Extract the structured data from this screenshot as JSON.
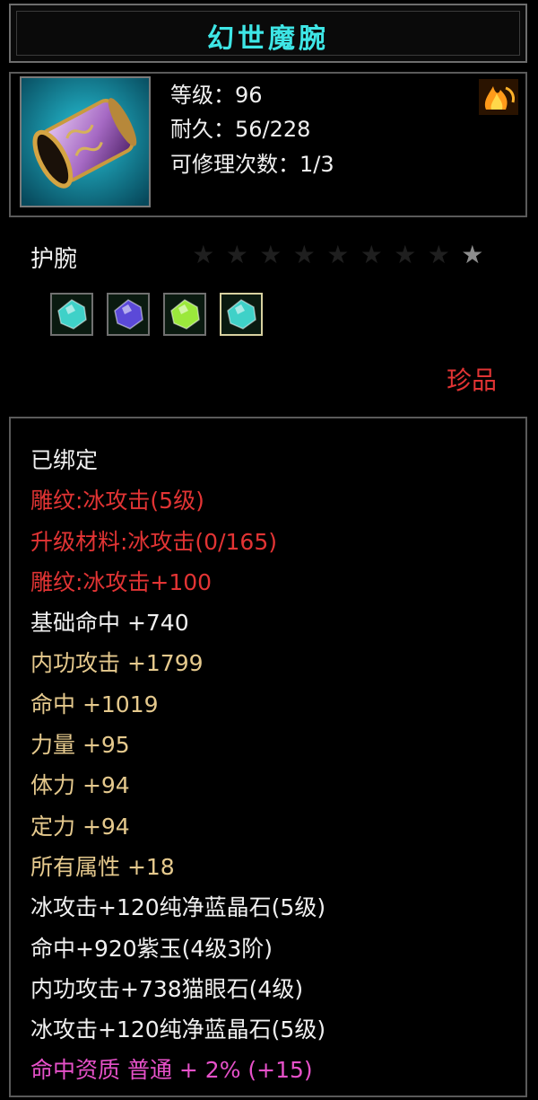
{
  "item": {
    "name": "幻世魔腕",
    "level_line": "等级：96",
    "durability_line": "耐久：56/228",
    "repair_line": "可修理次数：1/3",
    "type": "护腕",
    "star_total": 9,
    "stars_lit": 1,
    "rarity": "珍品",
    "icon": "wristguard-icon"
  },
  "gems": [
    {
      "icon": "cyan-gem-icon",
      "color": "#3fd1c8"
    },
    {
      "icon": "purple-gem-icon",
      "color": "#5b49d8"
    },
    {
      "icon": "green-gem-icon",
      "color": "#9be83c"
    },
    {
      "icon": "cyan-gem-icon",
      "color": "#3fd1c8"
    }
  ],
  "colors": {
    "title": "#3ee6e6",
    "white": "#f0f0f0",
    "gold": "#e5c98d",
    "red": "#e23434",
    "magenta": "#e651c9"
  },
  "attributes": [
    {
      "text": "已绑定",
      "color": "#f0f0f0"
    },
    {
      "text": "雕纹:冰攻击(5级)",
      "color": "#e23434"
    },
    {
      "text": "升级材料:冰攻击(0/165)",
      "color": "#e23434"
    },
    {
      "text": "雕纹:冰攻击+100",
      "color": "#e23434"
    },
    {
      "text": "基础命中 +740",
      "color": "#f0f0f0"
    },
    {
      "text": "内功攻击 +1799",
      "color": "#e5c98d"
    },
    {
      "text": "命中 +1019",
      "color": "#e5c98d"
    },
    {
      "text": "力量 +95",
      "color": "#e5c98d"
    },
    {
      "text": "体力 +94",
      "color": "#e5c98d"
    },
    {
      "text": "定力 +94",
      "color": "#e5c98d"
    },
    {
      "text": "所有属性 +18",
      "color": "#e5c98d"
    },
    {
      "text": "冰攻击+120纯净蓝晶石(5级)",
      "color": "#f0f0f0"
    },
    {
      "text": "命中+920紫玉(4级3阶)",
      "color": "#f0f0f0"
    },
    {
      "text": "内功攻击+738猫眼石(4级)",
      "color": "#f0f0f0"
    },
    {
      "text": "冰攻击+120纯净蓝晶石(5级)",
      "color": "#f0f0f0"
    },
    {
      "text": "命中资质 普通 + 2% (+15)",
      "color": "#e651c9"
    }
  ]
}
